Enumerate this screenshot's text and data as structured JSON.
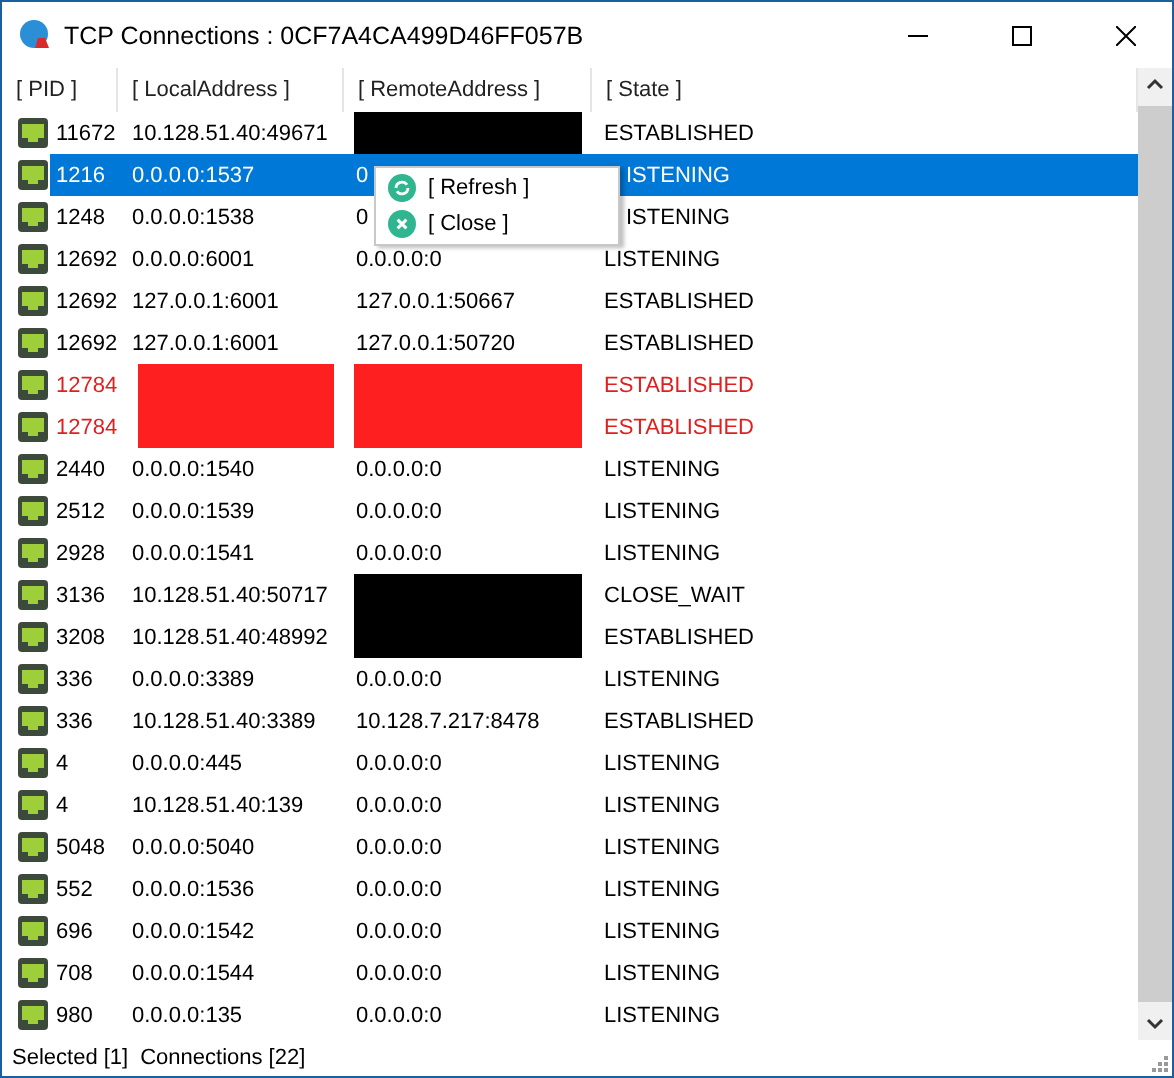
{
  "window": {
    "title": "TCP Connections : 0CF7A4CA499D46FF057B"
  },
  "columns": [
    "[ PID ]",
    "[ LocalAddress ]",
    "[ RemoteAddress ]",
    "[ State ]"
  ],
  "rows": [
    {
      "pid": "11672",
      "local": "10.128.51.40:49671",
      "remote_block": {
        "color": "#000000"
      },
      "state": "ESTABLISHED",
      "selected": false,
      "alert": false
    },
    {
      "pid": "1216",
      "local": "0.0.0.0:1537",
      "remote": "0",
      "state": "ISTENING",
      "selected": true,
      "alert": false
    },
    {
      "pid": "1248",
      "local": "0.0.0.0:1538",
      "remote": "0",
      "state": "ISTENING",
      "selected": false,
      "alert": false
    },
    {
      "pid": "12692",
      "local": "0.0.0.0:6001",
      "remote": "0.0.0.0:0",
      "state": "LISTENING",
      "selected": false,
      "alert": false
    },
    {
      "pid": "12692",
      "local": "127.0.0.1:6001",
      "remote": "127.0.0.1:50667",
      "state": "ESTABLISHED",
      "selected": false,
      "alert": false
    },
    {
      "pid": "12692",
      "local": "127.0.0.1:6001",
      "remote": "127.0.0.1:50720",
      "state": "ESTABLISHED",
      "selected": false,
      "alert": false
    },
    {
      "pid": "12784",
      "local_block": {
        "color": "#fe2020"
      },
      "remote_block": {
        "color": "#fe2020"
      },
      "state": "ESTABLISHED",
      "selected": false,
      "alert": true
    },
    {
      "pid": "12784",
      "local_block": {
        "color": "#fe2020"
      },
      "remote_block": {
        "color": "#fe2020"
      },
      "state": "ESTABLISHED",
      "selected": false,
      "alert": true
    },
    {
      "pid": "2440",
      "local": "0.0.0.0:1540",
      "remote": "0.0.0.0:0",
      "state": "LISTENING",
      "selected": false,
      "alert": false
    },
    {
      "pid": "2512",
      "local": "0.0.0.0:1539",
      "remote": "0.0.0.0:0",
      "state": "LISTENING",
      "selected": false,
      "alert": false
    },
    {
      "pid": "2928",
      "local": "0.0.0.0:1541",
      "remote": "0.0.0.0:0",
      "state": "LISTENING",
      "selected": false,
      "alert": false
    },
    {
      "pid": "3136",
      "local": "10.128.51.40:50717",
      "remote_block": {
        "color": "#000000"
      },
      "state": "CLOSE_WAIT",
      "selected": false,
      "alert": false
    },
    {
      "pid": "3208",
      "local": "10.128.51.40:48992",
      "remote_block": {
        "color": "#000000"
      },
      "state": "ESTABLISHED",
      "selected": false,
      "alert": false
    },
    {
      "pid": "336",
      "local": "0.0.0.0:3389",
      "remote": "0.0.0.0:0",
      "state": "LISTENING",
      "selected": false,
      "alert": false
    },
    {
      "pid": "336",
      "local": "10.128.51.40:3389",
      "remote": "10.128.7.217:8478",
      "state": "ESTABLISHED",
      "selected": false,
      "alert": false
    },
    {
      "pid": "4",
      "local": "0.0.0.0:445",
      "remote": "0.0.0.0:0",
      "state": "LISTENING",
      "selected": false,
      "alert": false
    },
    {
      "pid": "4",
      "local": "10.128.51.40:139",
      "remote": "0.0.0.0:0",
      "state": "LISTENING",
      "selected": false,
      "alert": false
    },
    {
      "pid": "5048",
      "local": "0.0.0.0:5040",
      "remote": "0.0.0.0:0",
      "state": "LISTENING",
      "selected": false,
      "alert": false
    },
    {
      "pid": "552",
      "local": "0.0.0.0:1536",
      "remote": "0.0.0.0:0",
      "state": "LISTENING",
      "selected": false,
      "alert": false
    },
    {
      "pid": "696",
      "local": "0.0.0.0:1542",
      "remote": "0.0.0.0:0",
      "state": "LISTENING",
      "selected": false,
      "alert": false
    },
    {
      "pid": "708",
      "local": "0.0.0.0:1544",
      "remote": "0.0.0.0:0",
      "state": "LISTENING",
      "selected": false,
      "alert": false
    },
    {
      "pid": "980",
      "local": "0.0.0.0:135",
      "remote": "0.0.0.0:0",
      "state": "LISTENING",
      "selected": false,
      "alert": false
    }
  ],
  "context_menu": [
    {
      "kind": "refresh",
      "label": "[ Refresh ]"
    },
    {
      "kind": "close",
      "label": "[ Close ]"
    }
  ],
  "status_bar": {
    "selected": "Selected [1]",
    "connections": "Connections [22]"
  }
}
